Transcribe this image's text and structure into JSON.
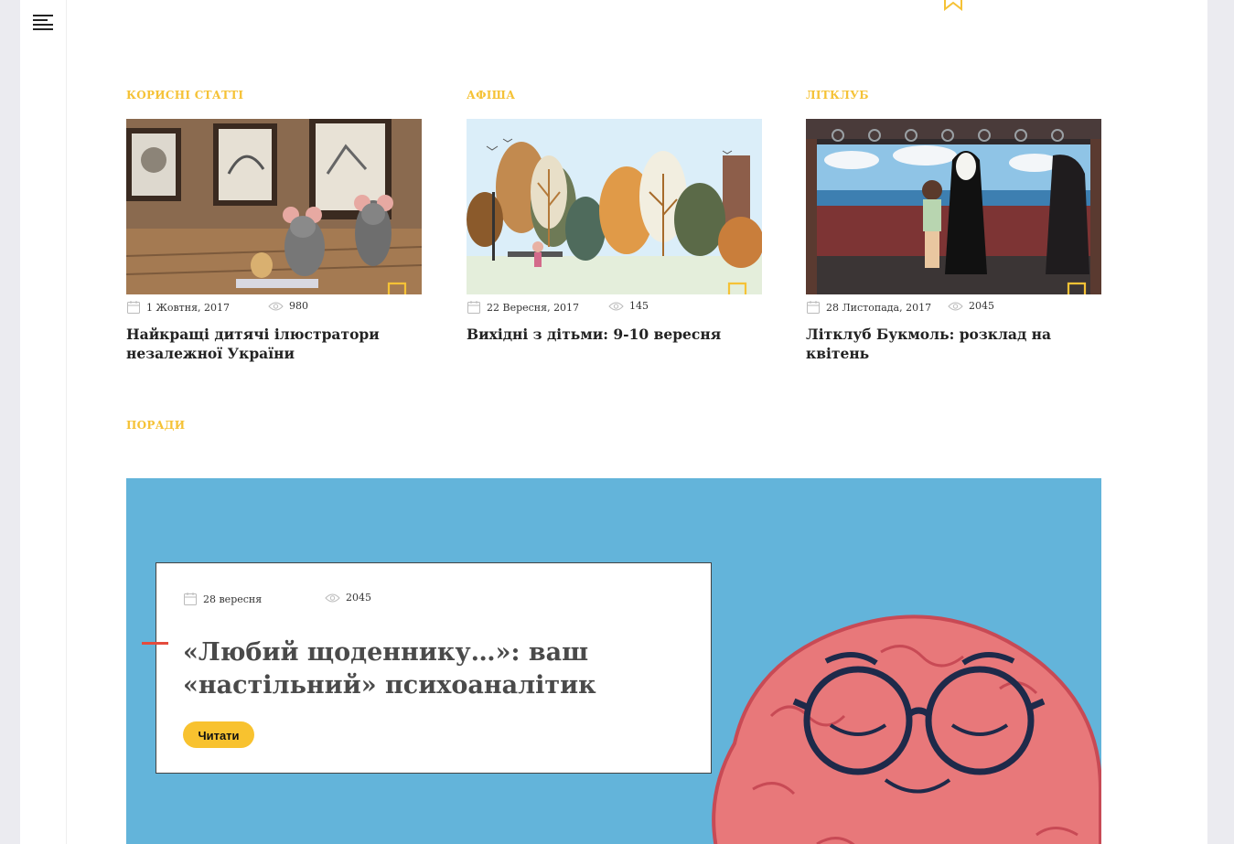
{
  "sections": {
    "useful": {
      "label": "КОРИСНІ СТАТТІ",
      "date": "1 Жовтня, 2017",
      "views": "980",
      "title": "Найкращі дитячі ілюстратори незалежної України"
    },
    "afisha": {
      "label": "АФІША",
      "date": "22 Вересня, 2017",
      "views": "145",
      "title": "Вихідні з дітьми: 9-10 вересня"
    },
    "litklub": {
      "label": "ЛІТКЛУБ",
      "date": "28 Листопада, 2017",
      "views": "2045",
      "title": "Літклуб Букмоль: розклад на квітень"
    }
  },
  "tips": {
    "label": "ПОРАДИ",
    "date": "28 вересня",
    "views": "2045",
    "title": "«Любий щоденнику…»: ваш «настільний» психоаналітик",
    "button": "Читати"
  },
  "colors": {
    "accent": "#f5c236",
    "hero_background": "#63b4da",
    "button": "#f8c22f",
    "red_marker": "#e44b3d"
  },
  "icons": [
    "menu-icon",
    "bookmark-icon",
    "calendar-icon",
    "eye-icon"
  ]
}
